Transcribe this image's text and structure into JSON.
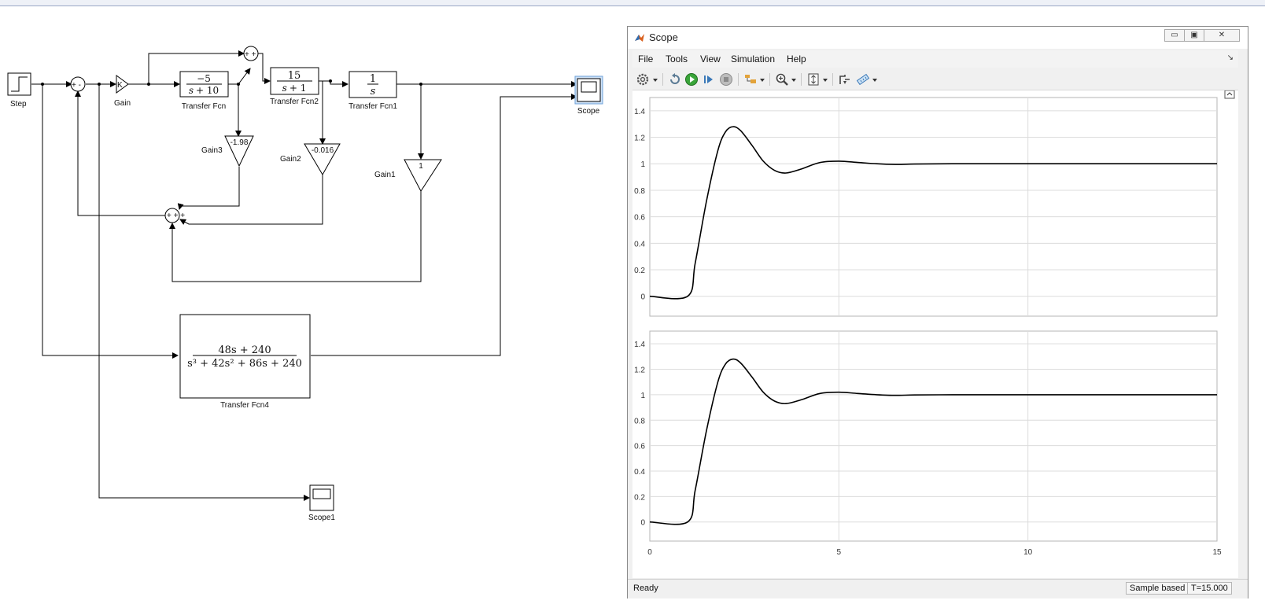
{
  "diagram": {
    "blocks": {
      "step": "Step",
      "gain": "Gain",
      "gain_symbol": "K",
      "tf": "Transfer Fcn",
      "tf_num": "−5",
      "tf_den_var": "s",
      "tf_den_rest": "+ 10",
      "tf2": "Transfer Fcn2",
      "tf2_num": "15",
      "tf2_den_var": "s",
      "tf2_den_rest": "+ 1",
      "tf1": "Transfer Fcn1",
      "tf1_num": "1",
      "tf1_den": "s",
      "scope": "Scope",
      "scope1": "Scope1",
      "gain3": "Gain3",
      "gain3_value": "-1.98",
      "gain2": "Gain2",
      "gain2_value": "-0.016",
      "gain1": "Gain1",
      "gain1_value": "1",
      "tf4": "Transfer Fcn4",
      "tf4_num": "48s + 240",
      "tf4_den": "s³ + 42s² + 86s + 240"
    },
    "sum1_signs": "+ -",
    "sum2_signs": "+ +",
    "sum3_signs": "+ + +"
  },
  "scope": {
    "title": "Scope",
    "menu": [
      "File",
      "Tools",
      "View",
      "Simulation",
      "Help"
    ],
    "toolbar_icons": [
      "settings-icon",
      "restore-icon",
      "run-icon",
      "step-forward-icon",
      "stop-icon",
      "highlight-icon",
      "zoom-in-icon",
      "fit-axes-icon",
      "triggers-icon",
      "measure-icon"
    ],
    "status": "Ready",
    "sample_mode": "Sample based",
    "time": "T=15.000",
    "accent_line": "#000000",
    "chart_data": [
      {
        "type": "line",
        "title": "",
        "xlabel": "",
        "ylabel": "",
        "xlim": [
          0,
          15
        ],
        "ylim": [
          -0.15,
          1.5
        ],
        "yticks": [
          "0",
          "0.2",
          "0.4",
          "0.6",
          "0.8",
          "1",
          "1.2",
          "1.4"
        ],
        "xticks": [],
        "grid": true,
        "series": [
          {
            "x": [
              0,
              1,
              1.2,
              1.5,
              1.8,
              2.0,
              2.2,
              2.4,
              2.7,
              3.0,
              3.3,
              3.6,
              4.0,
              4.5,
              5.0,
              5.5,
              6.0,
              6.5,
              7,
              8,
              9,
              10,
              11,
              12,
              13,
              14,
              15
            ],
            "values": [
              0,
              0,
              0.25,
              0.72,
              1.1,
              1.24,
              1.28,
              1.25,
              1.14,
              1.02,
              0.95,
              0.93,
              0.96,
              1.01,
              1.02,
              1.01,
              1.0,
              0.995,
              0.998,
              1.0,
              1.0,
              1.0,
              1.0,
              1.0,
              1.0,
              1.0,
              1.0
            ]
          }
        ]
      },
      {
        "type": "line",
        "title": "",
        "xlabel": "",
        "ylabel": "",
        "xlim": [
          0,
          15
        ],
        "ylim": [
          -0.15,
          1.5
        ],
        "yticks": [
          "0",
          "0.2",
          "0.4",
          "0.6",
          "0.8",
          "1",
          "1.2",
          "1.4"
        ],
        "xticks": [
          "0",
          "5",
          "10",
          "15"
        ],
        "grid": true,
        "series": [
          {
            "x": [
              0,
              1,
              1.2,
              1.5,
              1.8,
              2.0,
              2.2,
              2.4,
              2.7,
              3.0,
              3.3,
              3.6,
              4.0,
              4.5,
              5.0,
              5.5,
              6.0,
              6.5,
              7,
              8,
              9,
              10,
              11,
              12,
              13,
              14,
              15
            ],
            "values": [
              0,
              0,
              0.25,
              0.72,
              1.1,
              1.24,
              1.28,
              1.25,
              1.14,
              1.02,
              0.95,
              0.93,
              0.96,
              1.01,
              1.02,
              1.01,
              1.0,
              0.995,
              0.998,
              1.0,
              1.0,
              1.0,
              1.0,
              1.0,
              1.0,
              1.0,
              1.0
            ]
          }
        ]
      }
    ]
  }
}
